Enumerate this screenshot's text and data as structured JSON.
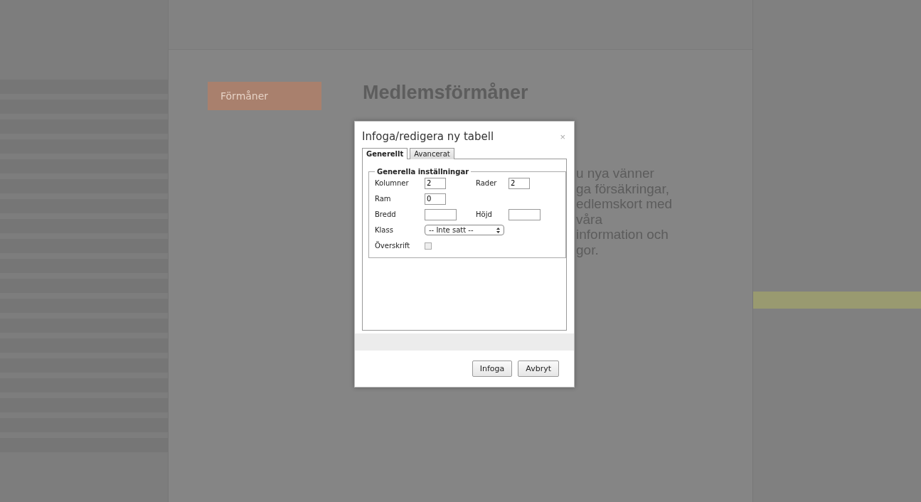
{
  "page": {
    "menu": [
      {
        "label": "Förmåner",
        "selected": true
      }
    ],
    "heading": "Medlemsförmåner",
    "body_lines": [
      "u nya vänner",
      "ga försäkringar,",
      "edlemskort med",
      "våra",
      "information och",
      "gor."
    ]
  },
  "dialog": {
    "title": "Infoga/redigera ny tabell",
    "close": "×",
    "tabs": [
      {
        "label": "Generellt",
        "selected": true
      },
      {
        "label": "Avancerat",
        "selected": false
      }
    ],
    "legend": "Generella inställningar",
    "rows": [
      [
        {
          "label": "Kolumner",
          "kind": "text",
          "value": "2"
        },
        {
          "label": "Rader",
          "kind": "text",
          "value": "2"
        }
      ],
      [
        {
          "label": "Ram",
          "kind": "text",
          "value": "0"
        }
      ],
      [
        {
          "label": "Bredd",
          "kind": "text"
        },
        {
          "label": "Höjd",
          "kind": "text"
        }
      ],
      [
        {
          "label": "Klass",
          "kind": "select",
          "value": "-- Inte satt --"
        }
      ],
      [
        {
          "label": "Överskrift",
          "kind": "checkbox",
          "checked": false
        }
      ]
    ],
    "buttons": [
      "Infoga",
      "Avbryt"
    ]
  }
}
